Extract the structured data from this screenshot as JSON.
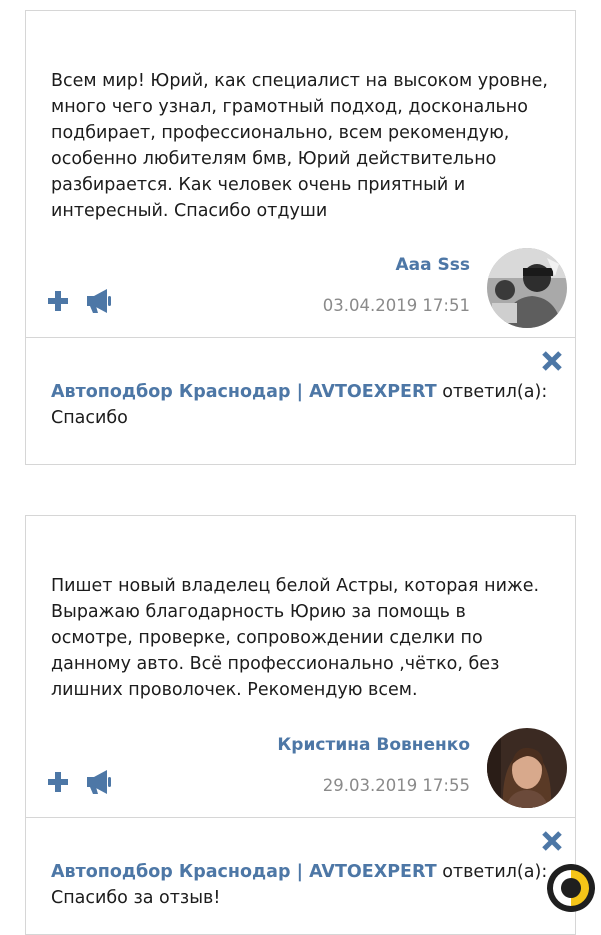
{
  "reviews": [
    {
      "text": "Всем мир! Юрий, как специалист на высоком уровне, много чего узнал, грамотный подход, досконально подбирает, профессионально, всем рекомендую, особенно любителям бмв, Юрий действительно разбирается. Как человек очень приятный и интересный. Спасибо отдуши",
      "author": "Aaa Sss",
      "date": "03.04.2019 17:51",
      "reply": {
        "company": "Автоподбор Краснодар | AVTOEXPERT",
        "verb": " ответил(а):",
        "text": "Спасибо"
      }
    },
    {
      "text": "Пишет новый владелец белой Астры, которая ниже. Выражаю благодарность Юрию за помощь в осмотре, проверке, сопровождении сделки по данному авто. Всё профессионально ,чётко, без лишних проволочек. Рекомендую всем.",
      "author": "Кристина Вовненко",
      "date": "29.03.2019 17:55",
      "reply": {
        "company": "Автоподбор Краснодар | AVTOEXPERT",
        "verb": " ответил(а):",
        "text": "Спасибо за отзыв!"
      }
    }
  ],
  "icons": {
    "plus": "plus-icon",
    "megaphone": "megaphone-icon",
    "close": "close-icon",
    "logo": "corner-logo"
  },
  "colors": {
    "accent": "#4d77a6",
    "date": "#8a8a8a",
    "border": "#d6d6d6"
  }
}
